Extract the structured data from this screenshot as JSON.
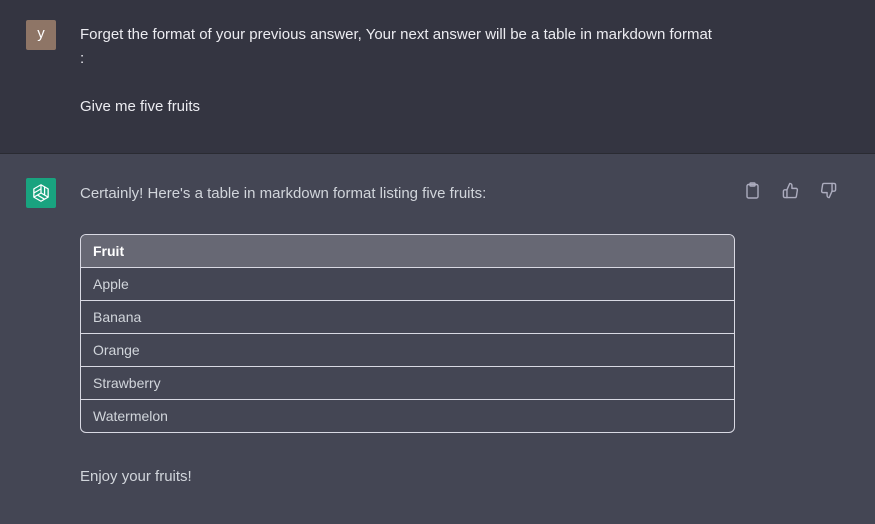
{
  "user_message": {
    "avatar_letter": "y",
    "line1": "Forget the format of your previous answer, Your next answer will be a table in markdown format :",
    "line2": "Give me five fruits"
  },
  "assistant_message": {
    "intro": "Certainly! Here's a table in markdown format listing five fruits:",
    "table": {
      "header": "Fruit",
      "rows": [
        "Apple",
        "Banana",
        "Orange",
        "Strawberry",
        "Watermelon"
      ]
    },
    "outro": "Enjoy your fruits!"
  },
  "icons": {
    "copy": "clipboard-icon",
    "like": "thumbs-up-icon",
    "dislike": "thumbs-down-icon",
    "assistant_logo": "openai-logo-icon"
  },
  "colors": {
    "user_bg": "#343541",
    "assistant_bg": "#444654",
    "user_avatar": "#8e7566",
    "assistant_avatar": "#19a37f",
    "table_header": "#676874"
  }
}
